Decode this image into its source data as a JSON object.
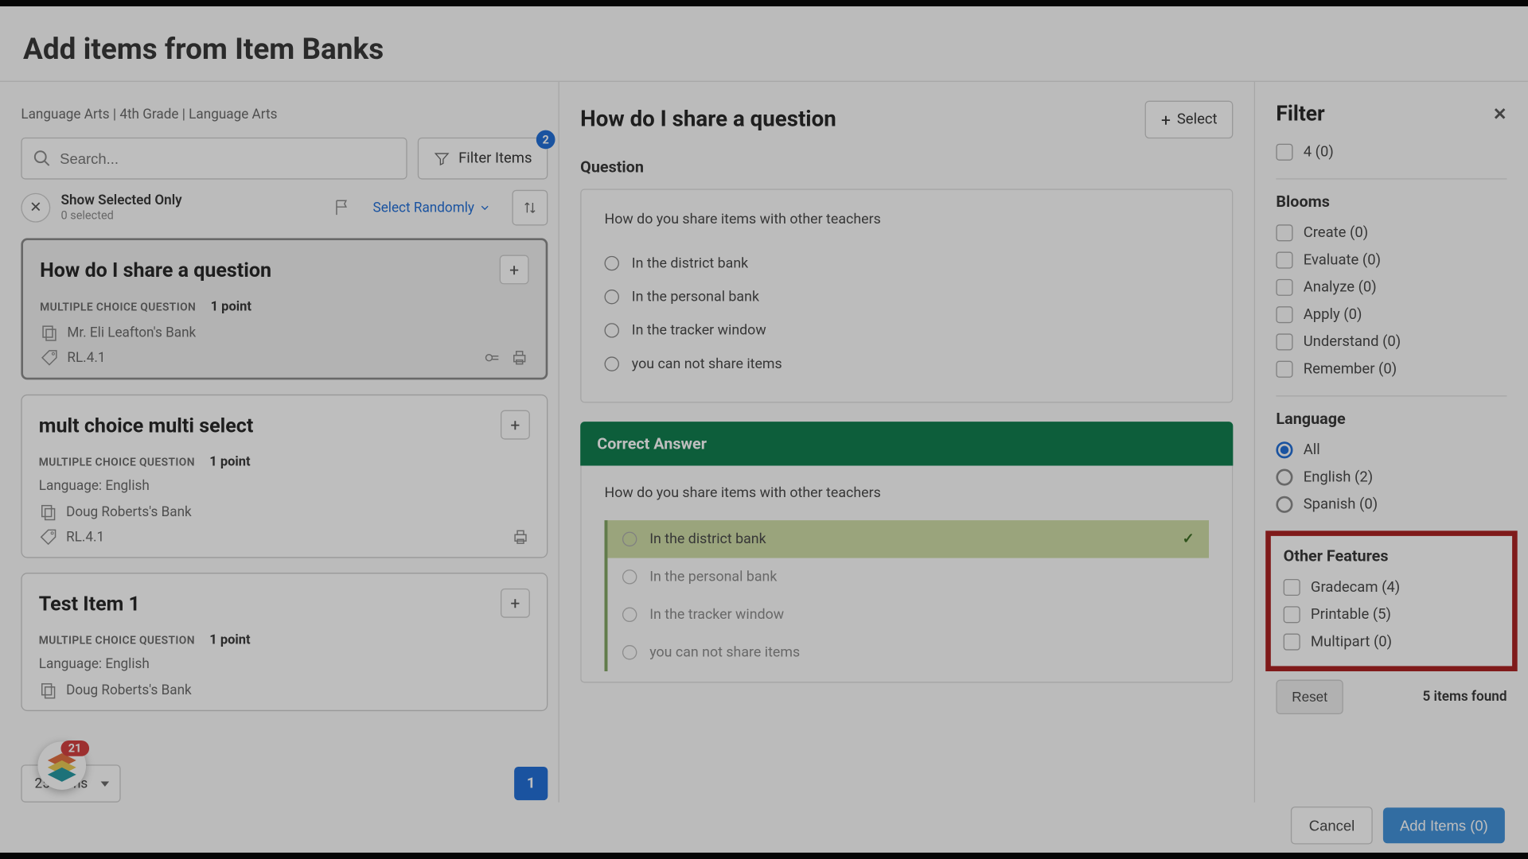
{
  "pageTitle": "Add items from Item Banks",
  "breadcrumb": "Language Arts | 4th Grade | Language Arts",
  "search": {
    "placeholder": "Search..."
  },
  "filterItemsLabel": "Filter Items",
  "filterItemsBadge": "2",
  "showSelected": {
    "title": "Show Selected Only",
    "sub": "0 selected"
  },
  "selectRandomLabel": "Select Randomly",
  "items": [
    {
      "title": "How do I share a question",
      "type": "MULTIPLE CHOICE QUESTION",
      "points": "1 point",
      "bank": "Mr. Eli Leafton's Bank",
      "standard": "RL.4.1",
      "language": "",
      "active": true,
      "showExtraIcons": true
    },
    {
      "title": "mult choice multi select",
      "type": "MULTIPLE CHOICE QUESTION",
      "points": "1 point",
      "language": "Language: English",
      "bank": "Doug Roberts's Bank",
      "standard": "RL.4.1",
      "active": false,
      "showExtraIcons": false
    },
    {
      "title": "Test Item 1",
      "type": "MULTIPLE CHOICE QUESTION",
      "points": "1 point",
      "language": "Language: English",
      "bank": "Doug Roberts's Bank",
      "standard": "",
      "active": false,
      "showExtraIcons": false
    }
  ],
  "pageSize": "25 Items",
  "pageNum": "1",
  "preview": {
    "title": "How do I share a question",
    "selectLabel": "Select",
    "questionSection": "Question",
    "questionText": "How do you share items with other teachers",
    "options": [
      "In the district bank",
      "In the personal bank",
      "In the tracker window",
      "you can not share items"
    ],
    "correctLabel": "Correct Answer",
    "correctIndex": 0
  },
  "filter": {
    "title": "Filter",
    "top": "4 (0)",
    "bloomsTitle": "Blooms",
    "blooms": [
      "Create (0)",
      "Evaluate (0)",
      "Analyze (0)",
      "Apply (0)",
      "Understand (0)",
      "Remember (0)"
    ],
    "languageTitle": "Language",
    "languages": [
      {
        "label": "All",
        "selected": true
      },
      {
        "label": "English (2)",
        "selected": false
      },
      {
        "label": "Spanish (0)",
        "selected": false
      }
    ],
    "otherTitle": "Other Features",
    "other": [
      "Gradecam (4)",
      "Printable (5)",
      "Multipart (0)"
    ],
    "resetLabel": "Reset",
    "foundLabel": "5 items found"
  },
  "footer": {
    "cancel": "Cancel",
    "add": "Add Items (0)"
  },
  "notif": "21"
}
